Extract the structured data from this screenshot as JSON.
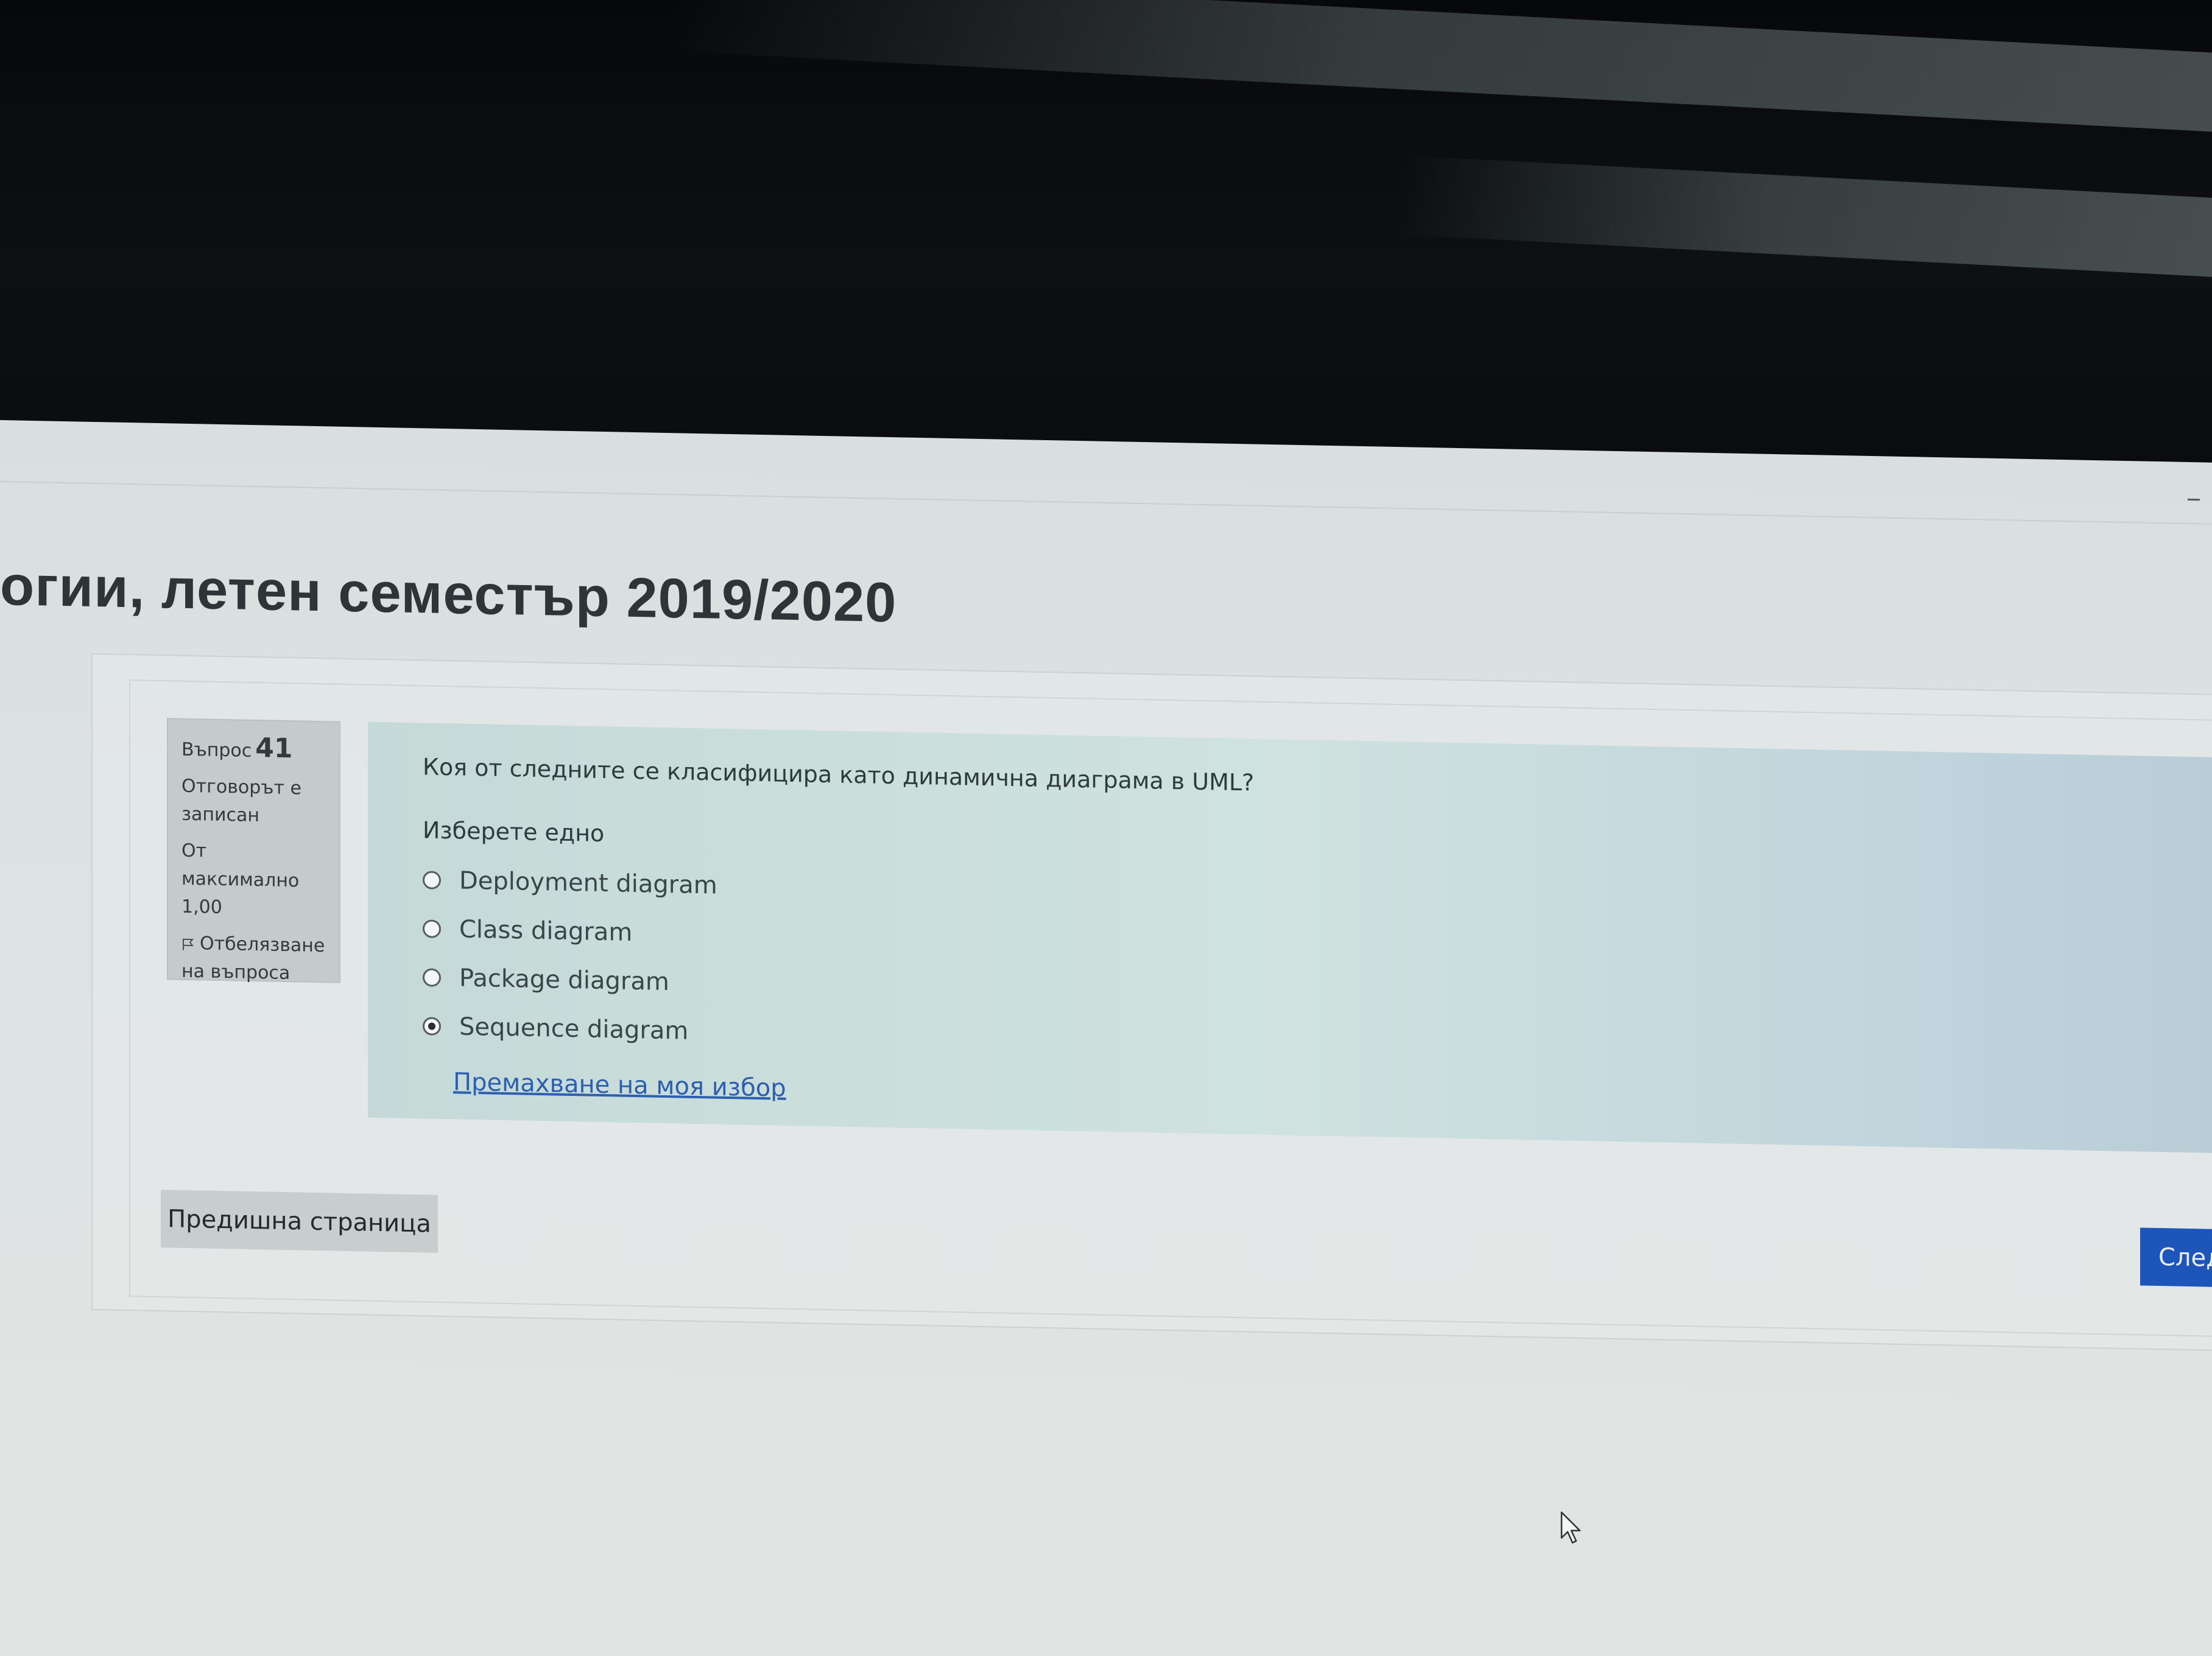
{
  "page": {
    "title": "огии, летен семестър 2019/2020"
  },
  "question_info": {
    "label": "Въпрос",
    "number": "41",
    "status": "Отговорът е записан",
    "max_label": "От максимално",
    "max_value": "1,00",
    "flag_label": "Отбелязване на въпроса"
  },
  "question": {
    "text": "Коя от следните се класифицира като динамична диаграма в UML?",
    "prompt": "Изберете едно",
    "answers": [
      {
        "label": "Deployment diagram",
        "selected": false
      },
      {
        "label": "Class diagram",
        "selected": false
      },
      {
        "label": "Package diagram",
        "selected": false
      },
      {
        "label": "Sequence diagram",
        "selected": true
      }
    ],
    "clear_choice": "Премахване на моя избор"
  },
  "navigation": {
    "prev_label": "Предишна страница",
    "next_label": "Следващ"
  },
  "colors": {
    "accent": "#1d56b8",
    "link": "#2d5fb0",
    "formulation_bg": "#cfe2df"
  }
}
